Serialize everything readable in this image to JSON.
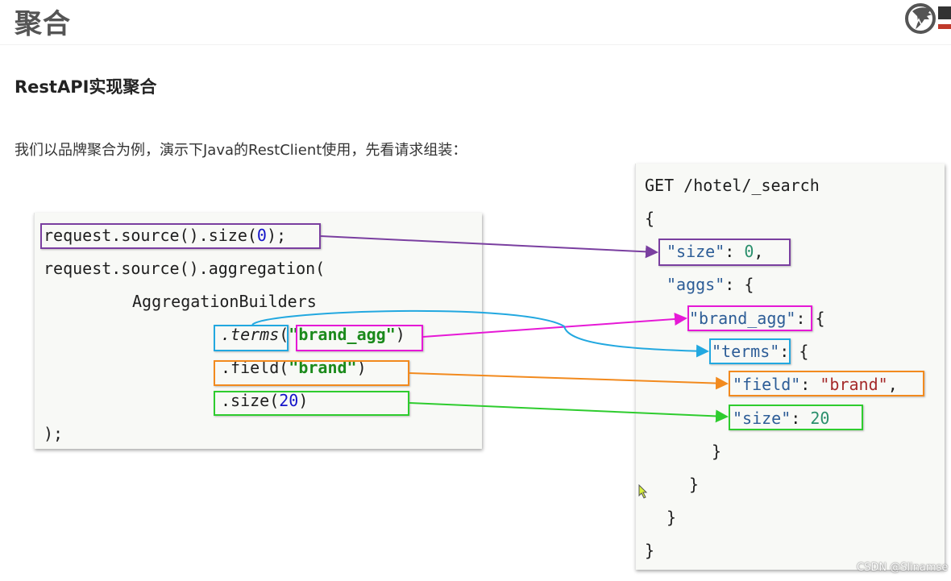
{
  "header": {
    "title": "聚合",
    "logo_icon": "horse-logo-icon"
  },
  "section": {
    "title": "RestAPI实现聚合",
    "intro": "我们以品牌聚合为例，演示下Java的RestClient使用，先看请求组装："
  },
  "java_code": {
    "line1_prefix": "request.source().size(",
    "line1_num": "0",
    "line1_suffix": ");",
    "line2": "request.source().aggregation(",
    "line3": "AggregationBuilders",
    "line4_method": ".terms",
    "line4_open": "(",
    "line4_arg": "\"brand_agg\"",
    "line4_close": ")",
    "line5_prefix": ".field(",
    "line5_arg": "\"brand\"",
    "line5_close": ")",
    "line6_prefix": ".size(",
    "line6_num": "20",
    "line6_close": ")",
    "line7": ");"
  },
  "json_code": {
    "request_line": "GET /hotel/_search",
    "open_brace": "{",
    "size_key": "\"size\"",
    "size_colon": ": ",
    "size_value": "0",
    "size_comma": ",",
    "aggs_key": "\"aggs\"",
    "aggs_rest": ": {",
    "agg_name_key": "\"brand_agg\"",
    "agg_name_rest": ": {",
    "terms_key": "\"terms\"",
    "terms_rest": ": {",
    "field_key": "\"field\"",
    "field_colon": ": ",
    "field_value": "\"brand\"",
    "field_comma": ",",
    "size2_key": "\"size\"",
    "size2_colon": ": ",
    "size2_value": "20",
    "close1": "}",
    "close2": "}",
    "close3": "}",
    "close4": "}"
  },
  "colors": {
    "size_link": "#7a3fa0",
    "terms_link": "#22a8e0",
    "name_link": "#e619d6",
    "field_link": "#f28a1e",
    "size20_link": "#2ecc2e"
  },
  "watermark": "CSDN @Slinamse",
  "cursor_icon": "mouse-pointer-icon"
}
